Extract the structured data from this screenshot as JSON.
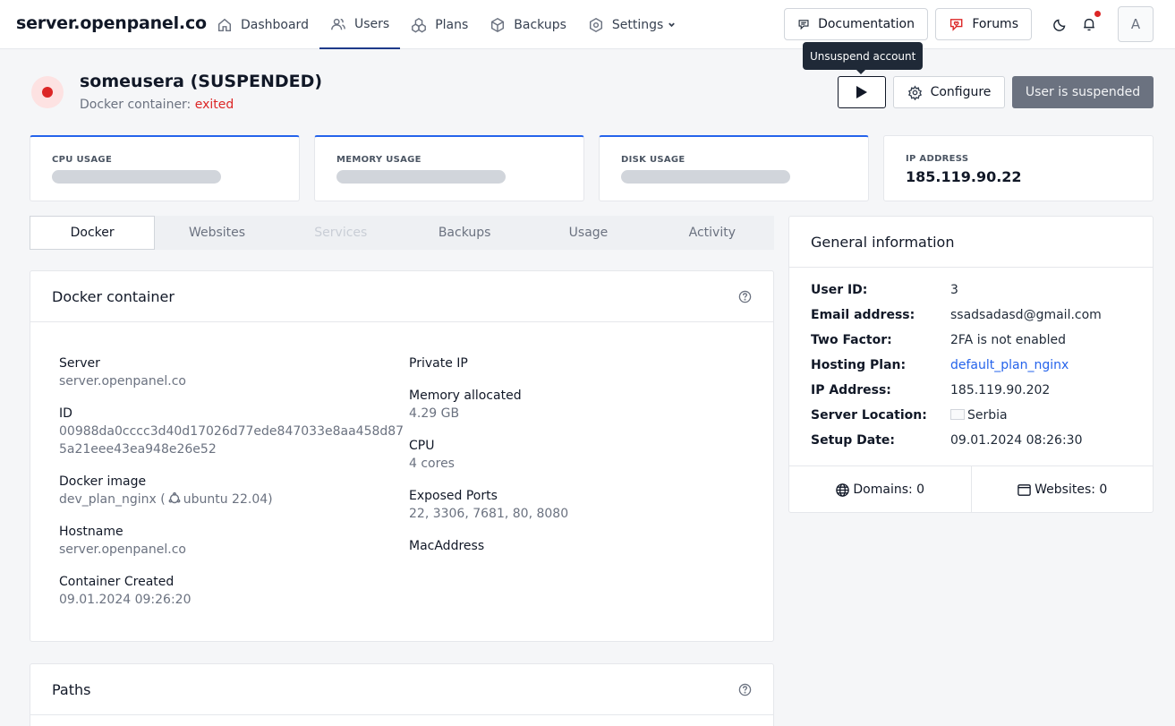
{
  "brand": "server.openpanel.co",
  "nav": [
    {
      "label": "Dashboard",
      "icon": "home-icon"
    },
    {
      "label": "Users",
      "icon": "users-icon"
    },
    {
      "label": "Plans",
      "icon": "plans-icon"
    },
    {
      "label": "Backups",
      "icon": "box-icon"
    },
    {
      "label": "Settings",
      "icon": "gear-icon"
    }
  ],
  "header": {
    "documentation": "Documentation",
    "forums": "Forums",
    "avatar": "A"
  },
  "user": {
    "title": "someusera (SUSPENDED)",
    "container_label": "Docker container:",
    "container_status": "exited"
  },
  "actions": {
    "tooltip": "Unsuspend account",
    "configure": "Configure",
    "suspended": "User is suspended"
  },
  "stats": {
    "cpu_label": "CPU USAGE",
    "memory_label": "MEMORY USAGE",
    "disk_label": "DISK USAGE",
    "ip_label": "IP ADDRESS",
    "ip_value": "185.119.90.22"
  },
  "tabs": [
    "Docker",
    "Websites",
    "Services",
    "Backups",
    "Usage",
    "Activity"
  ],
  "docker": {
    "title": "Docker container",
    "server_label": "Server",
    "server": "server.openpanel.co",
    "id_label": "ID",
    "id_line1": "00988da0cccc3d40d17026d77ede847033e8aa458d87",
    "id_line2": "5a21eee43ea948e26e52",
    "image_label": "Docker image",
    "image_name": "dev_plan_nginx (",
    "image_os": "ubuntu 22.04)",
    "hostname_label": "Hostname",
    "hostname": "server.openpanel.co",
    "created_label": "Container Created",
    "created": "09.01.2024 09:26:20",
    "private_ip_label": "Private IP",
    "memory_label": "Memory allocated",
    "memory": "4.29 GB",
    "cpu_label": "CPU",
    "cpu": "4 cores",
    "ports_label": "Exposed Ports",
    "ports": "22, 3306, 7681, 80, 8080",
    "mac_label": "MacAddress"
  },
  "paths": {
    "title": "Paths"
  },
  "general": {
    "title": "General information",
    "rows": [
      {
        "k": "User ID:",
        "v": "3"
      },
      {
        "k": "Email address:",
        "v": "ssadsadasd@gmail.com"
      },
      {
        "k": "Two Factor:",
        "v": "2FA is not enabled"
      },
      {
        "k": "Hosting Plan:",
        "v": "default_plan_nginx"
      },
      {
        "k": "IP Address:",
        "v": "185.119.90.202"
      },
      {
        "k": "Server Location:",
        "v": "Serbia"
      },
      {
        "k": "Setup Date:",
        "v": "09.01.2024 08:26:30"
      }
    ],
    "domains": "Domains: 0",
    "websites": "Websites: 0"
  }
}
